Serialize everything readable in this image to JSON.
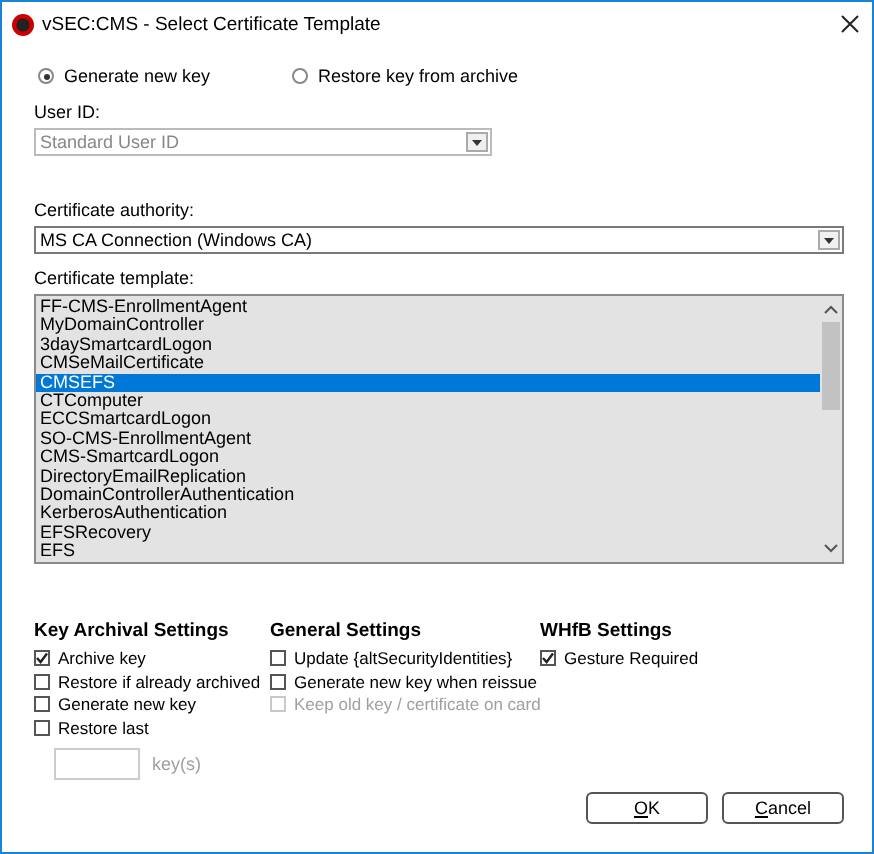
{
  "window": {
    "title": "vSEC:CMS - Select Certificate Template"
  },
  "key_mode": [
    {
      "label": "Generate new key",
      "selected": true
    },
    {
      "label": "Restore key from archive",
      "selected": false
    }
  ],
  "user_id": {
    "label": "User ID:",
    "value": "Standard User ID",
    "disabled": true
  },
  "certificate_authority": {
    "label": "Certificate authority:",
    "value": "MS CA Connection (Windows CA)",
    "disabled": false
  },
  "certificate_template": {
    "label": "Certificate template:",
    "items": [
      {
        "label": "FF-CMS-EnrollmentAgent",
        "selected": false
      },
      {
        "label": "MyDomainController",
        "selected": false
      },
      {
        "label": "3daySmartcardLogon",
        "selected": false
      },
      {
        "label": "CMSeMailCertificate",
        "selected": false
      },
      {
        "label": "CMSEFS",
        "selected": true
      },
      {
        "label": "CTComputer",
        "selected": false
      },
      {
        "label": "ECCSmartcardLogon",
        "selected": false
      },
      {
        "label": "SO-CMS-EnrollmentAgent",
        "selected": false
      },
      {
        "label": "CMS-SmartcardLogon",
        "selected": false
      },
      {
        "label": "DirectoryEmailReplication",
        "selected": false
      },
      {
        "label": "DomainControllerAuthentication",
        "selected": false
      },
      {
        "label": "KerberosAuthentication",
        "selected": false
      },
      {
        "label": "EFSRecovery",
        "selected": false
      },
      {
        "label": "EFS",
        "selected": false
      }
    ]
  },
  "settings": [
    {
      "title": "Key Archival Settings",
      "options": [
        {
          "label": "Archive key",
          "checked": true,
          "disabled": false
        },
        {
          "label": "Restore if already archived",
          "checked": false,
          "disabled": false
        },
        {
          "label": "Generate new key",
          "checked": false,
          "disabled": false
        },
        {
          "label": "Restore last",
          "checked": false,
          "disabled": false
        }
      ],
      "key_count": {
        "unit": "key(s)",
        "disabled": true
      }
    },
    {
      "title": "General Settings",
      "options": [
        {
          "label": "Update {altSecurityIdentities}",
          "checked": false,
          "disabled": false
        },
        {
          "label": "Generate new key when reissue",
          "checked": false,
          "disabled": false
        },
        {
          "label": "Keep old key / certificate on card",
          "checked": false,
          "disabled": true
        }
      ]
    },
    {
      "title": "WHfB Settings",
      "options": [
        {
          "label": "Gesture Required",
          "checked": true,
          "disabled": false
        }
      ]
    }
  ],
  "buttons": [
    "OK",
    "Cancel"
  ]
}
